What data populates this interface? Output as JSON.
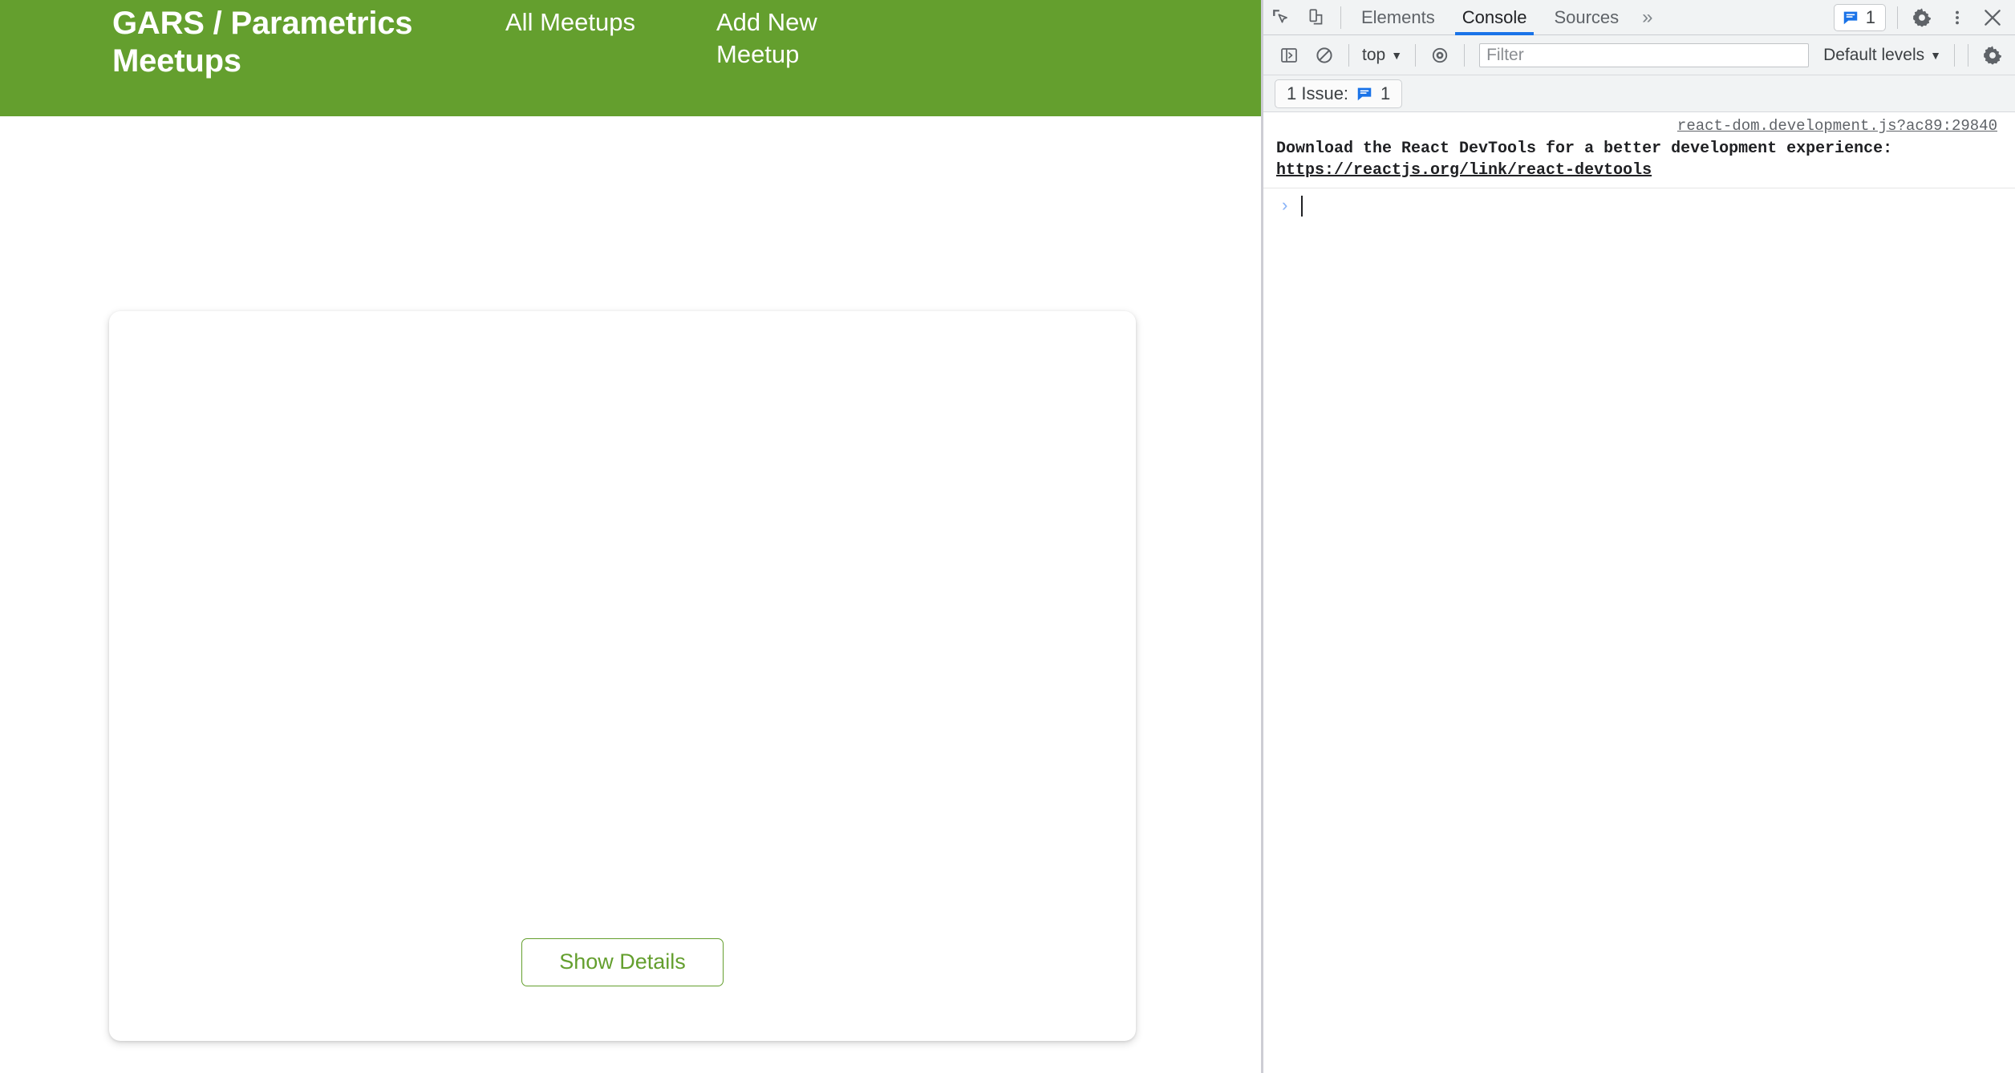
{
  "page": {
    "header": {
      "brand_title": "GARS / Parametrics Meetups",
      "nav": [
        {
          "label": "All Meetups",
          "name": "nav-link-all-meetups"
        },
        {
          "label": "Add New Meetup",
          "name": "nav-link-add-new-meetup"
        }
      ],
      "background_color": "#649F2E",
      "text_color": "#FFFFFF"
    },
    "main": {
      "card": {
        "action_label": "Show Details",
        "accent_color": "#649F2E"
      }
    }
  },
  "devtools": {
    "tabbar": {
      "inspect_icon": "cursor-select-icon",
      "device_toolbar_icon": "device-toggle-icon",
      "tabs": [
        {
          "label": "Elements",
          "active": false
        },
        {
          "label": "Console",
          "active": true
        },
        {
          "label": "Sources",
          "active": false
        }
      ],
      "more_tabs_label": "»",
      "issues_count": "1",
      "settings_icon": "gear-icon",
      "more_options_icon": "kebab-menu-icon",
      "close_icon": "close-icon",
      "active_tab_underline_color": "#1A73E8"
    },
    "console_toolbar": {
      "sidebar_toggle_icon": "console-sidebar-icon",
      "clear_icon": "clear-console-icon",
      "context_selector": "top",
      "live_expression_icon": "eye-icon",
      "filter_placeholder": "Filter",
      "filter_value": "",
      "levels_selector": "Default levels",
      "settings_icon": "gear-icon"
    },
    "issues_bar": {
      "label": "1 Issue:",
      "icon": "issue-message-icon",
      "count": "1",
      "icon_color": "#1A73E8"
    },
    "console": {
      "messages": [
        {
          "source": "react-dom.development.js?ac89:29840",
          "text": "Download the React DevTools for a better development experience:",
          "link": "https://reactjs.org/link/react-devtools"
        }
      ],
      "prompt_arrow": "›",
      "prompt_value": ""
    }
  }
}
